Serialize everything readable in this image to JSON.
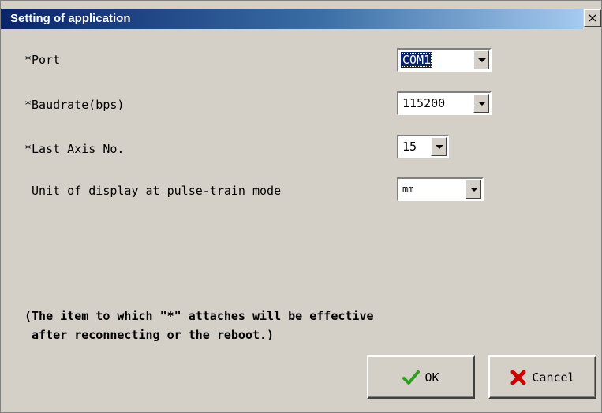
{
  "window": {
    "title": "Setting of application",
    "close_glyph": "×"
  },
  "fields": [
    {
      "label": "*Port",
      "value": "COM1"
    },
    {
      "label": "*Baudrate(bps)",
      "value": "115200"
    },
    {
      "label": "*Last Axis No.",
      "value": "15"
    },
    {
      "label": " Unit of display at pulse-train mode",
      "value": "mm"
    }
  ],
  "note": "(The item to which \"*\" attaches will be effective\n after reconnecting or the reboot.)",
  "buttons": {
    "ok": "OK",
    "cancel": "Cancel"
  },
  "icons": {
    "ok": "checkmark-icon",
    "cancel": "x-icon"
  },
  "colors": {
    "title_start": "#0a246a",
    "ok_icon": "#2e9e1e",
    "cancel_icon": "#cc0000"
  }
}
